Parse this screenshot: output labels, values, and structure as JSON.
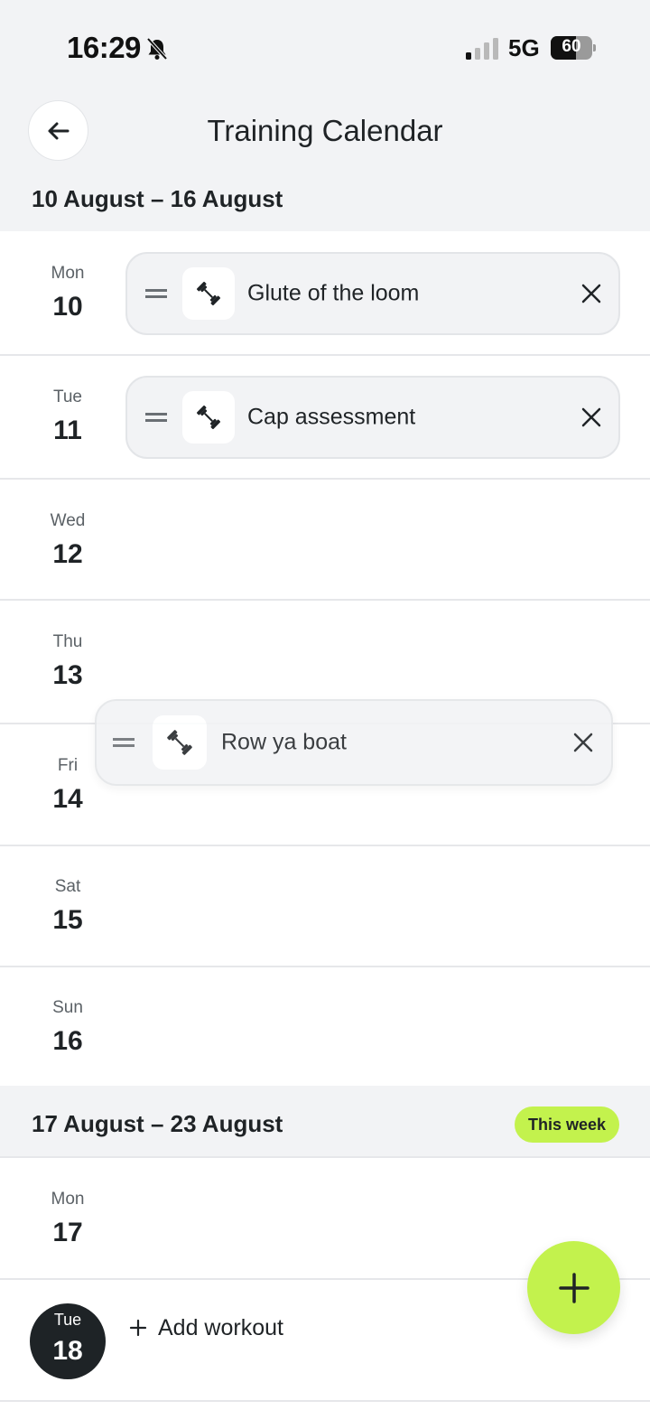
{
  "status_bar": {
    "time": "16:29",
    "network": "5G",
    "battery": "60",
    "battery_level": 0.6
  },
  "header": {
    "title": "Training Calendar",
    "back_icon": "arrow-left-icon"
  },
  "weeks": [
    {
      "range": "10 August – 16 August",
      "days": [
        {
          "dow": "Mon",
          "num": "10"
        },
        {
          "dow": "Tue",
          "num": "11"
        },
        {
          "dow": "Wed",
          "num": "12"
        },
        {
          "dow": "Thu",
          "num": "13"
        },
        {
          "dow": "Fri",
          "num": "14"
        },
        {
          "dow": "Sat",
          "num": "15"
        },
        {
          "dow": "Sun",
          "num": "16"
        }
      ]
    },
    {
      "range": "17 August – 23 August",
      "badge": "This week",
      "days": [
        {
          "dow": "Mon",
          "num": "17"
        },
        {
          "dow": "Tue",
          "num": "18"
        }
      ]
    }
  ],
  "workouts": [
    {
      "name": "Glute of the loom",
      "day": "Mon 10",
      "icon": "dumbbell-icon"
    },
    {
      "name": "Cap assessment",
      "day": "Tue 11",
      "icon": "dumbbell-icon"
    },
    {
      "name": "Row ya boat",
      "day": "dragging",
      "icon": "dumbbell-icon"
    }
  ],
  "add_workout_label": "Add workout",
  "colors": {
    "accent": "#c3f24d",
    "background": "#f2f3f5",
    "today": "#1e2326"
  }
}
